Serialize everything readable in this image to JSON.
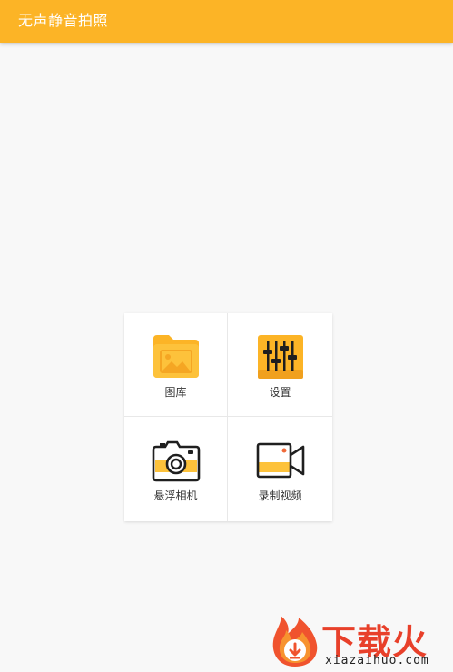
{
  "app": {
    "title": "无声静音拍照"
  },
  "menu": {
    "items": [
      {
        "label": "图库",
        "icon": "gallery-folder-icon"
      },
      {
        "label": "设置",
        "icon": "settings-sliders-icon"
      },
      {
        "label": "悬浮相机",
        "icon": "floating-camera-icon"
      },
      {
        "label": "录制视频",
        "icon": "video-record-icon"
      }
    ]
  },
  "watermark": {
    "brand": "下载火",
    "domain": "xiazaihuo.com"
  },
  "colors": {
    "accent": "#fcb426",
    "icon_yellow": "#fdc233",
    "icon_dark": "#1f1f1f",
    "watermark": "#e8402a"
  }
}
